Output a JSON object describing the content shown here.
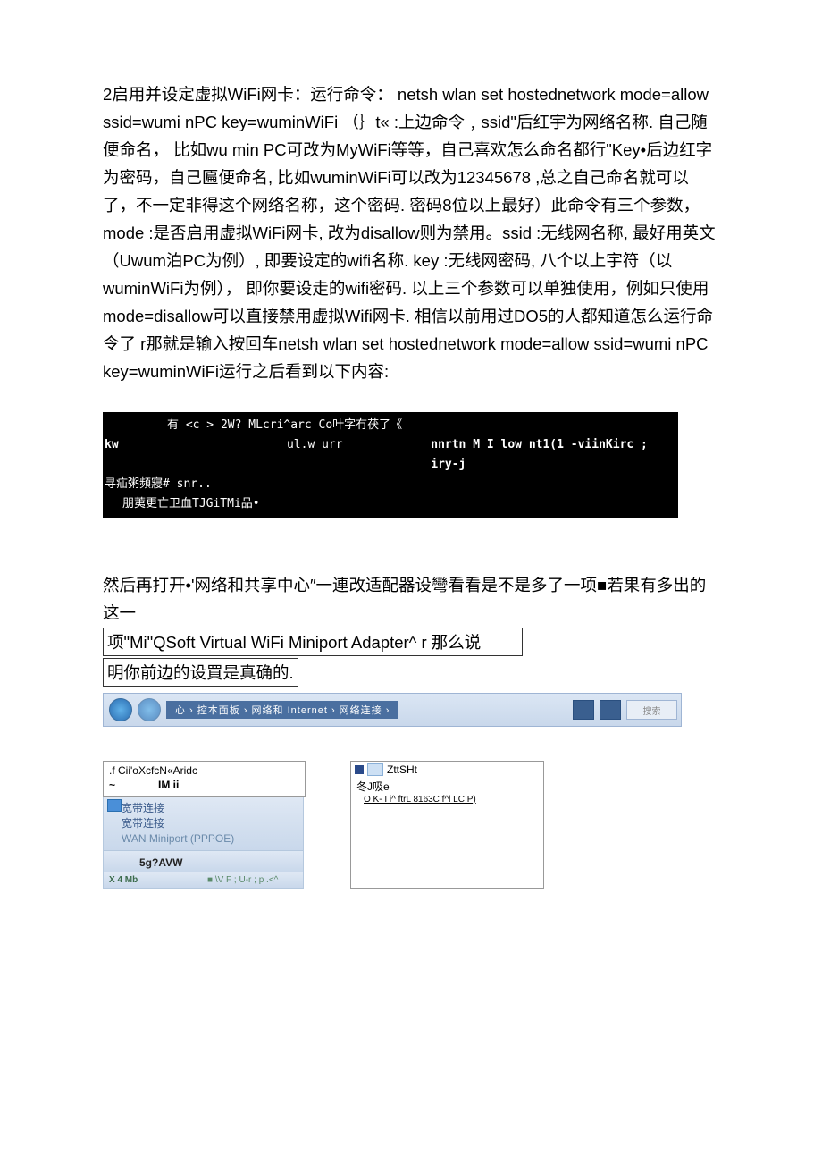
{
  "body_text": "2启用并设定虚拟WiFi网卡：运行命令：  netsh wlan set hostednetwork mode=allow ssid=wumi nPC key=wuminWiFi （｝t« :上边命令﹐ssid\"后红宇为网络名称. 自己随便命名， 比如wu min PC可改为MyWiFi等等，自己喜欢怎么命名都行\"Key•后边红字为密码，自己匾便命名, 比如wuminWiFi可以改为12345678 ,总之自己命名就可以了，不一定非得这个网络名称，这个密码. 密码8位以上最好）此命令有三个参数， mode :是否启用虚拟WiFi网卡, 改为disallow则为禁用。ssid :无线网名称, 最好用英文（Uwum泊PC为例）, 即要设定的wifi名称. key :无线网密码, 八个以上宇符（以wuminWiFi为例）， 即你要设走的wifi密码. 以上三个参数可以单独使用，例如只使用mode=disallow可以直接禁用虚拟Wifi网卡. 相信以前用过DO5的人都知道怎么运行命令了 r那就是输入按回车netsh wlan set hostednetwork mode=allow ssid=wumi nPC key=wuminWiFi运行之后看到以下内容:",
  "terminal": {
    "line1": "有  <c > 2W? MLcri^arc Co叶字冇茯了《",
    "line2_a": "kw",
    "line2_b": "ul.w urr",
    "line2_c": "nnrtn M I low nt1(1 -viinKirc ;  iry-j",
    "line3": "寻疝粥頻寢#  snr..",
    "line4": "朋荑更亡卫血TJGiTMi品•"
  },
  "body_text2_a": "然后再打开•'网络和共享中心″一連改适配器设彎看看是不是多了一项■若果有多出的这一",
  "boxed1": "项\"Mi\"QSoft Virtual WiFi Miniport Adapter^ r 那么说",
  "boxed2": "明你前边的设買是真确的.",
  "winbar": {
    "crumb": "心  ›  控本面板  ›  网络和 Internet  ›  网络连接  ›",
    "search": "搜索"
  },
  "adapter_left": {
    "r1": ".f Cii'oXcfcN«Aridc",
    "r2_tilde": "~",
    "r2_imii": "IM ii",
    "bb_line1": "宽带连接",
    "bb_line2": "宽带连接",
    "bb_line3": "WAN Miniport (PPPOE)",
    "bb2": "5g?AVW",
    "bb3_left": "X 4 Mb",
    "bb3_right": "■ \\V F ; U-r ; p .<^"
  },
  "adapter_right": {
    "r1": "ZttSHt",
    "r2": "冬J吸e",
    "r3": "O K- I i^ ftrL 8163C f^l LC P)"
  }
}
